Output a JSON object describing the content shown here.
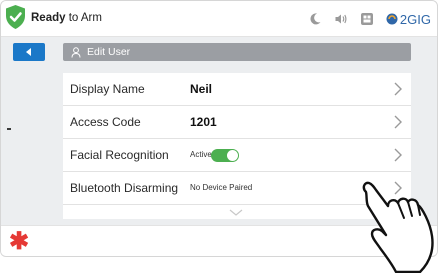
{
  "status": {
    "state_bold": "Ready",
    "state_rest": " to Arm",
    "brand": "2GIG",
    "icons": [
      "moon-icon",
      "volume-icon",
      "dashboard-icon",
      "brand-logo-icon"
    ]
  },
  "header": {
    "back_icon": "back-arrow-icon",
    "title": "Edit User",
    "user_icon": "user-icon"
  },
  "rows": [
    {
      "label": "Display Name",
      "value": "Neil"
    },
    {
      "label": "Access Code",
      "value": "1201"
    },
    {
      "label": "Facial Recognition",
      "status": "Active",
      "toggle_on": true
    },
    {
      "label": "Bluetooth Disarming",
      "status": "No Device Paired"
    }
  ],
  "colors": {
    "accent": "#1b78c8",
    "shield": "#4caf50",
    "toggle": "#4caf50",
    "asterisk": "#e53935"
  }
}
